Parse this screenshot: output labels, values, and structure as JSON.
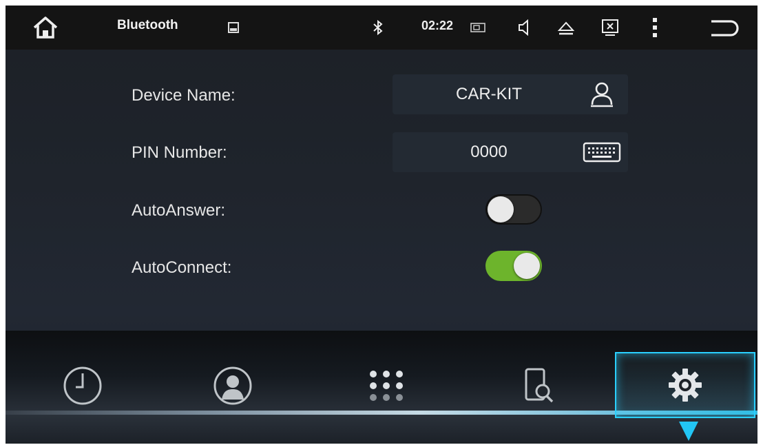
{
  "status_bar": {
    "title": "Bluetooth",
    "time": "02:22",
    "icons": [
      "home-icon",
      "gallery-icon",
      "bluetooth-icon",
      "screen-icon",
      "volume-icon",
      "eject-icon",
      "close-window-icon",
      "more-icon",
      "back-icon"
    ]
  },
  "settings": {
    "device_name_label": "Device Name:",
    "device_name_value": "CAR-KIT",
    "pin_label": "PIN Number:",
    "pin_value": "0000",
    "auto_answer_label": "AutoAnswer:",
    "auto_answer_on": false,
    "auto_connect_label": "AutoConnect:",
    "auto_connect_on": true
  },
  "nav": {
    "items": [
      "recent-calls",
      "contacts",
      "dialpad",
      "search-device",
      "settings"
    ],
    "active": "settings",
    "accent": "#2ad0ff"
  },
  "colors": {
    "toggle_on": "#6db42c",
    "background": "#1f242c"
  }
}
